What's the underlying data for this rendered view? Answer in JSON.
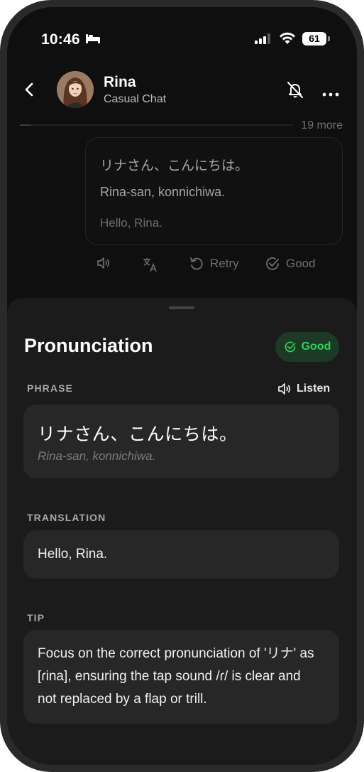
{
  "status_bar": {
    "time": "10:46",
    "battery": "61"
  },
  "header": {
    "name": "Rina",
    "subtitle": "Casual Chat"
  },
  "chat": {
    "more_count": "19 more",
    "message": {
      "japanese": "リナさん、こんにちは。",
      "romaji": "Rina-san, konnichiwa.",
      "english": "Hello, Rina."
    },
    "actions": {
      "retry": "Retry",
      "good": "Good"
    }
  },
  "sheet": {
    "title": "Pronunciation",
    "badge": "Good",
    "phrase": {
      "label": "PHRASE",
      "listen": "Listen",
      "japanese": "リナさん、こんにちは。",
      "romaji": "Rina-san, konnichiwa."
    },
    "translation": {
      "label": "TRANSLATION",
      "text": "Hello, Rina."
    },
    "tip": {
      "label": "TIP",
      "text": "Focus on the correct pronunciation of 'リナ' as [ɾina], ensuring the tap sound /ɾ/ is clear and not replaced by a flap or trill."
    }
  },
  "colors": {
    "accent_green": "#2fd25e",
    "badge_bg": "#1c3a26",
    "sheet_bg": "#1b1b1b",
    "card_bg": "#272727"
  }
}
